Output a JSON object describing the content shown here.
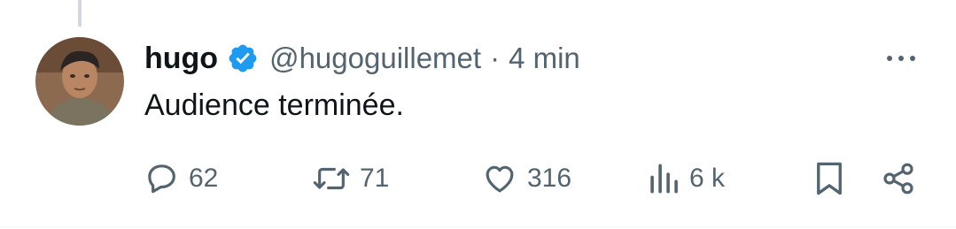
{
  "tweet": {
    "author_name": "hugo",
    "handle": "@hugoguillemet",
    "separator": "·",
    "time": "4 min",
    "text": "Audience terminée."
  },
  "actions": {
    "replies": "62",
    "retweets": "71",
    "likes": "316",
    "views": "6 k"
  },
  "icons": {
    "verified": "verified-badge-icon",
    "more": "more-dots-icon",
    "reply": "reply-icon",
    "retweet": "retweet-icon",
    "like": "heart-icon",
    "views": "views-chart-icon",
    "bookmark": "bookmark-icon",
    "share": "share-icon"
  },
  "colors": {
    "verified_blue": "#1d9bf0",
    "text_primary": "#0f1419",
    "text_secondary": "#536471"
  }
}
